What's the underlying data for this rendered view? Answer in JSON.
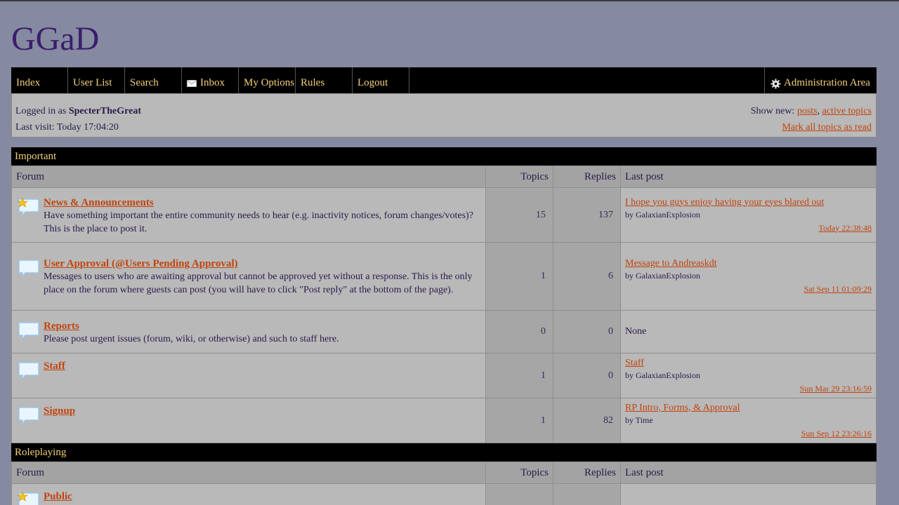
{
  "site": {
    "title": "GGaD"
  },
  "nav": {
    "items": [
      "Index",
      "User List",
      "Search",
      "Inbox",
      "My Options",
      "Rules",
      "Logout"
    ],
    "admin": "Administration Area"
  },
  "status": {
    "logged_prefix": "Logged in as ",
    "username": "SpecterTheGreat",
    "last_visit": "Last visit: Today 17:04:20",
    "show_new": "Show new: ",
    "posts": "posts",
    "comma": ", ",
    "active_topics": "active topics",
    "mark_read": "Mark all topics as read"
  },
  "table_headers": {
    "forum": "Forum",
    "topics": "Topics",
    "replies": "Replies",
    "last_post": "Last post"
  },
  "sections": [
    {
      "title": "Important",
      "forums": [
        {
          "name": "News & Announcements",
          "desc": "Have something important the entire community needs to hear (e.g. inactivity notices, forum changes/votes)? This is the place to post it.",
          "topics": "15",
          "replies": "137",
          "last_title": "I hope you guys enjoy having your eyes blared out",
          "last_by": "by GalaxianExplosion",
          "last_date": "Today 22:38:48",
          "starred": true
        },
        {
          "name": "User Approval (@Users Pending Approval)",
          "desc": "Messages to users who are awaiting approval but cannot be approved yet without a response. This is the only place on the forum where guests can post (you will have to click \"Post reply\" at the bottom of the page).",
          "topics": "1",
          "replies": "6",
          "last_title": "Message to Andreaskdt",
          "last_by": "by GalaxianExplosion",
          "last_date": "Sat Sep 11 01:09:29",
          "starred": false
        },
        {
          "name": "Reports",
          "desc": "Please post urgent issues (forum, wiki, or otherwise) and such to staff here.",
          "topics": "0",
          "replies": "0",
          "last_none": "None",
          "starred": false
        },
        {
          "name": "Staff",
          "desc": "",
          "topics": "1",
          "replies": "0",
          "last_title": "Staff",
          "last_by": "by GalaxianExplosion",
          "last_date": "Sun Mar 29 23:16:59",
          "starred": false
        },
        {
          "name": "Signup",
          "desc": "",
          "topics": "1",
          "replies": "82",
          "last_title": "RP Intro, Forms, & Approval",
          "last_by": "by Time",
          "last_date": "Sun Sep 12 23:26:16",
          "starred": false
        }
      ]
    },
    {
      "title": "Roleplaying",
      "forums": [
        {
          "name": "Public",
          "desc": "",
          "topics": "",
          "replies": "",
          "starred": true
        }
      ]
    }
  ]
}
